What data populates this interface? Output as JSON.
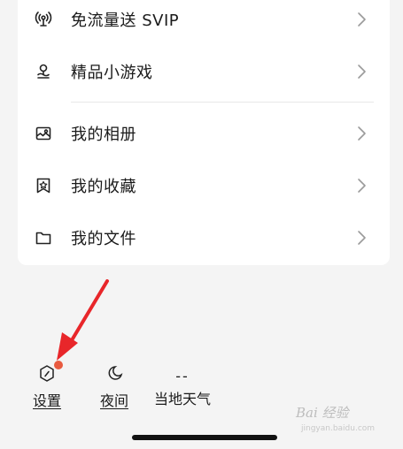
{
  "menu": {
    "items": [
      {
        "label": "免流量送 SVIP",
        "icon": "antenna-icon"
      },
      {
        "label": "精品小游戏",
        "icon": "game-location-icon"
      },
      {
        "label": "我的相册",
        "icon": "photo-album-icon"
      },
      {
        "label": "我的收藏",
        "icon": "bookmark-star-icon"
      },
      {
        "label": "我的文件",
        "icon": "folder-icon"
      }
    ]
  },
  "toolbar": {
    "settings_label": "设置",
    "night_label": "夜间",
    "weather_value": "--",
    "weather_label": "当地天气"
  },
  "watermark": {
    "text": "Bai 经验",
    "sub": "jingyan.baidu.com"
  },
  "colors": {
    "accent_red": "#e85a3f",
    "arrow_red": "#e8262a"
  }
}
